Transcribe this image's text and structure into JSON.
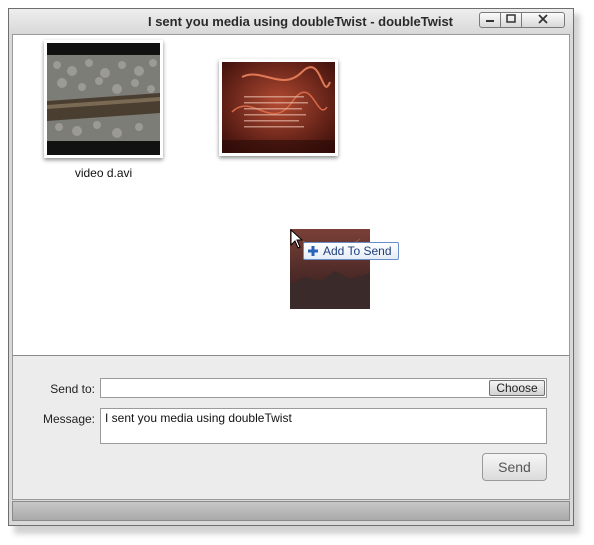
{
  "window": {
    "title": "I sent you media using doubleTwist - doubleTwist",
    "minimize_icon": "minimize-icon",
    "maximize_icon": "maximize-icon",
    "close_icon": "close-icon"
  },
  "media": {
    "items": [
      {
        "caption": "video d.avi",
        "kind": "video-thumbnail"
      },
      {
        "caption": "",
        "kind": "image-thumbnail"
      }
    ]
  },
  "drag": {
    "tooltip_label": "Add To Send",
    "icon": "plus-icon"
  },
  "form": {
    "send_to_label": "Send to:",
    "send_to_value": "",
    "choose_label": "Choose",
    "message_label": "Message:",
    "message_value": "I sent you media using doubleTwist",
    "send_label": "Send"
  }
}
